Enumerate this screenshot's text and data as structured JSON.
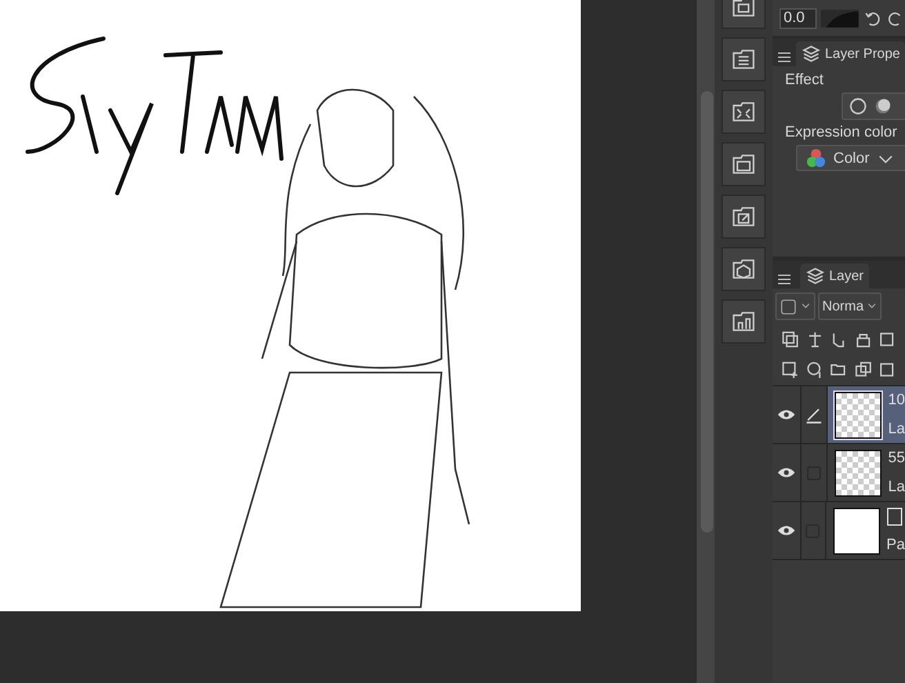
{
  "top_strip": {
    "value": "0.0"
  },
  "layer_property": {
    "tab": "Layer Prope",
    "effect_label": "Effect",
    "expression_color_label": "Expression color",
    "expression_color": "Color"
  },
  "layer_panel": {
    "tab": "Layer",
    "blend_mode": "Norma",
    "layers": [
      {
        "kind": "raster",
        "name": "10",
        "subtitle": "La",
        "selected": true,
        "editing": true
      },
      {
        "kind": "raster",
        "name": "55",
        "subtitle": "La",
        "selected": false,
        "editing": false
      },
      {
        "kind": "paper",
        "subtitle": "Pa",
        "selected": false,
        "editing": false
      }
    ]
  }
}
